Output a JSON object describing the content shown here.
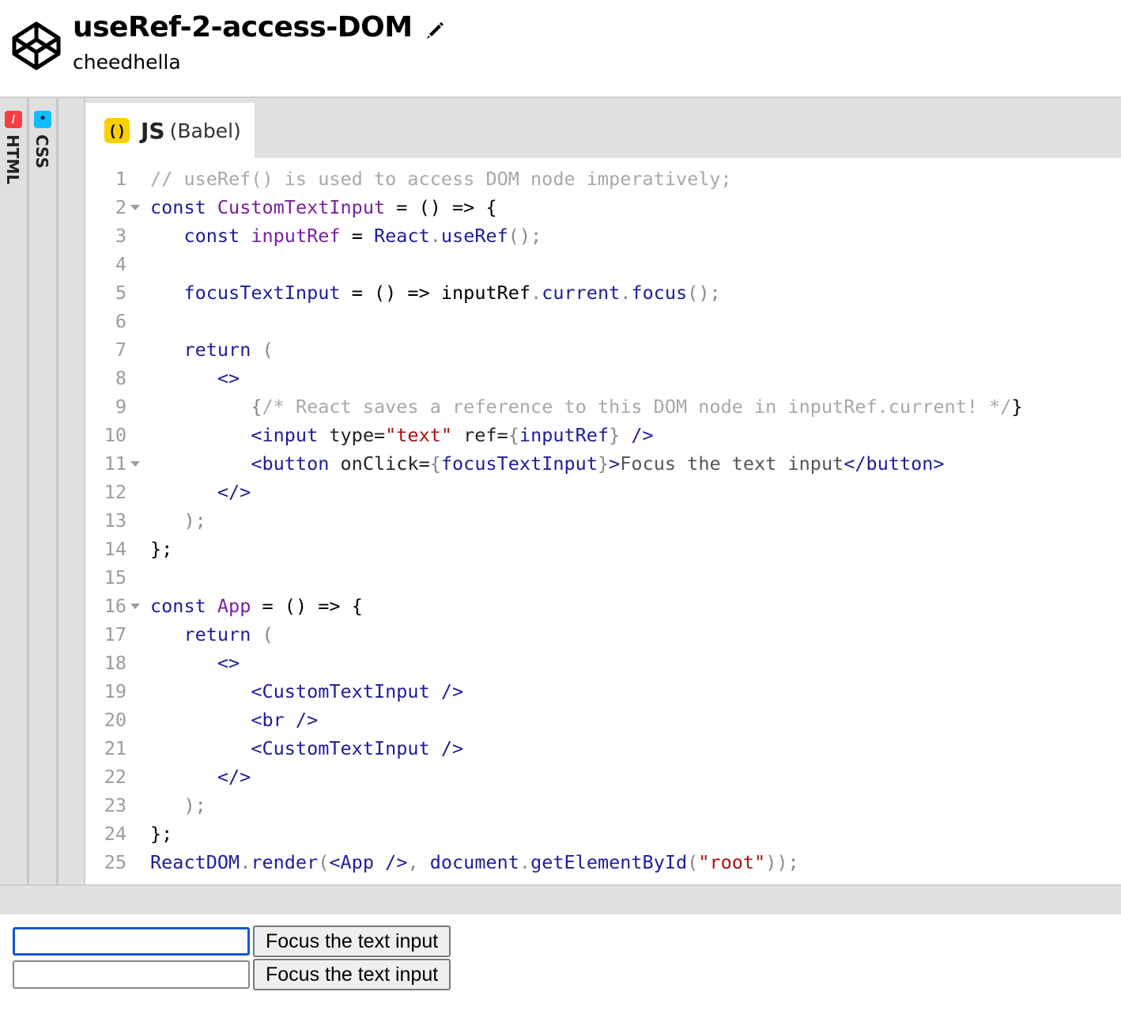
{
  "header": {
    "title": "useRef-2-access-DOM",
    "author": "cheedhella"
  },
  "panes": {
    "html_label": "HTML",
    "css_label": "CSS",
    "css_badge": "*"
  },
  "js_tab": {
    "name": "JS",
    "sub": "(Babel)"
  },
  "code_lines": [
    {
      "n": "1"
    },
    {
      "n": "2"
    },
    {
      "n": "3"
    },
    {
      "n": "4"
    },
    {
      "n": "5"
    },
    {
      "n": "6"
    },
    {
      "n": "7"
    },
    {
      "n": "8"
    },
    {
      "n": "9"
    },
    {
      "n": "10"
    },
    {
      "n": "11"
    },
    {
      "n": "12"
    },
    {
      "n": "13"
    },
    {
      "n": "14"
    },
    {
      "n": "15"
    },
    {
      "n": "16"
    },
    {
      "n": "17"
    },
    {
      "n": "18"
    },
    {
      "n": "19"
    },
    {
      "n": "20"
    },
    {
      "n": "21"
    },
    {
      "n": "22"
    },
    {
      "n": "23"
    },
    {
      "n": "24"
    },
    {
      "n": "25"
    }
  ],
  "code": {
    "l1": "// useRef() is used to access DOM node imperatively;",
    "l2a": "const",
    "l2b": "CustomTextInput",
    "l2c": " = () => {",
    "l3a": "const",
    "l3b": "inputRef",
    "l3c": " = ",
    "l3d": "React",
    "l3e": ".",
    "l3f": "useRef",
    "l3g": "();",
    "l5a": "focusTextInput",
    "l5b": " = () => ",
    "l5c": "inputRef",
    "l5d": ".",
    "l5e": "current",
    "l5f": ".",
    "l5g": "focus",
    "l5h": "();",
    "l7a": "return",
    "l7b": " (",
    "l8": "<>",
    "l9a": "{",
    "l9b": "/* React saves a reference to this DOM node in inputRef.current! */",
    "l9c": "}",
    "l10a": "<input",
    "l10b": " type=",
    "l10c": "\"text\"",
    "l10d": " ref=",
    "l10e": "{",
    "l10f": "inputRef",
    "l10g": "}",
    "l10h": " />",
    "l11a": "<button",
    "l11b": " onClick=",
    "l11c": "{",
    "l11d": "focusTextInput",
    "l11e": "}",
    "l11f": ">",
    "l11g": "Focus the text input",
    "l11h": "</button>",
    "l12": "</>",
    "l13": ");",
    "l14": "};",
    "l16a": "const",
    "l16b": "App",
    "l16c": " = () => {",
    "l17a": "return",
    "l17b": " (",
    "l18": "<>",
    "l19": "<CustomTextInput />",
    "l20": "<br />",
    "l21": "<CustomTextInput />",
    "l22": "</>",
    "l23": ");",
    "l24": "};",
    "l25a": "ReactDOM",
    "l25b": ".",
    "l25c": "render",
    "l25d": "(",
    "l25e": "<App />",
    "l25f": ", ",
    "l25g": "document",
    "l25h": ".",
    "l25i": "getElementById",
    "l25j": "(",
    "l25k": "\"root\"",
    "l25l": "));"
  },
  "preview": {
    "button1_label": "Focus the text input",
    "button2_label": "Focus the text input",
    "input1_value": "",
    "input2_value": ""
  },
  "colors": {
    "js_badge": "#fcd000",
    "html_badge": "#ff3c41",
    "css_badge": "#0ebeff",
    "focus_ring": "#1358d0"
  }
}
